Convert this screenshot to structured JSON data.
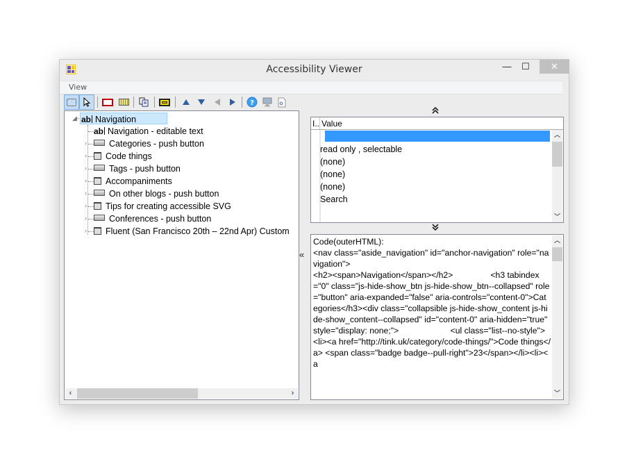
{
  "window": {
    "title": "Accessibility Viewer",
    "controls": {
      "minimize": "—",
      "maximize": "☐",
      "close": "✕"
    }
  },
  "menu": {
    "items": [
      {
        "label": "View"
      }
    ]
  },
  "toolbar": {
    "buttons": [
      {
        "name": "select-region",
        "icon": "dashed-rect-icon",
        "active": true
      },
      {
        "name": "pointer",
        "icon": "cursor-arrow-icon",
        "active": true
      },
      {
        "name": "highlight-red",
        "icon": "red-rect-icon"
      },
      {
        "name": "keyboard",
        "icon": "keyboard-icon"
      },
      {
        "name": "copy",
        "icon": "copy-icon"
      },
      {
        "name": "highlight-yellow",
        "icon": "yellow-rect-icon"
      },
      {
        "name": "nav-parent",
        "icon": "triangle-up-icon"
      },
      {
        "name": "nav-child",
        "icon": "triangle-down-icon"
      },
      {
        "name": "nav-previous",
        "icon": "triangle-left-icon"
      },
      {
        "name": "nav-next",
        "icon": "triangle-right-icon"
      },
      {
        "name": "help",
        "icon": "help-icon"
      },
      {
        "name": "screen",
        "icon": "monitor-icon"
      },
      {
        "name": "settings-doc",
        "icon": "document-gear-icon"
      }
    ]
  },
  "tree": {
    "root": {
      "icon": "ab",
      "label": "Navigation",
      "expanded": true,
      "selected": true
    },
    "children": [
      {
        "type": "editable",
        "icon": "ab",
        "label": "Navigation - editable text",
        "expandable": false
      },
      {
        "type": "button",
        "label": "Categories - push button",
        "expandable": true
      },
      {
        "type": "grouping",
        "label": "Code things",
        "expandable": true
      },
      {
        "type": "button",
        "label": "Tags - push button",
        "expandable": true
      },
      {
        "type": "grouping",
        "label": "Accompaniments",
        "expandable": true
      },
      {
        "type": "button",
        "label": "On other blogs - push button",
        "expandable": true
      },
      {
        "type": "grouping",
        "label": "Tips for creating accessible SVG",
        "expandable": true
      },
      {
        "type": "button",
        "label": "Conferences - push button",
        "expandable": true
      },
      {
        "type": "grouping",
        "label": "Fluent (San Francisco 20th – 22nd Apr) Custom",
        "expandable": true
      }
    ]
  },
  "properties": {
    "columns": {
      "index": "I..",
      "value": "Value"
    },
    "rows": [
      {
        "value": "",
        "selected": true
      },
      {
        "value": "read only , selectable"
      },
      {
        "value": "(none)"
      },
      {
        "value": "(none)"
      },
      {
        "value": "(none)"
      },
      {
        "value": "Search"
      }
    ]
  },
  "splitters": {
    "up": "⌃",
    "down": "⌄",
    "left": "«"
  },
  "code": {
    "text": "Code(outerHTML):\n<nav class=\"aside_navigation\" id=\"anchor-navigation\" role=\"navigation\">\n<h2><span>Navigation</span></h2>                <h3 tabindex=\"0\" class=\"js-hide-show_btn js-hide-show_btn--collapsed\" role=\"button\" aria-expanded=\"false\" aria-controls=\"content-0\">Categories</h3><div class=\"collapsible js-hide-show_content js-hide-show_content--collapsed\" id=\"content-0\" aria-hidden=\"true\" style=\"display: none;\">                      <ul class=\"list--no-style\">                  <li><a href=\"http://tink.uk/category/code-things/\">Code things</a> <span class=\"badge badge--pull-right\">23</span></li><li><a"
  },
  "scroll": {
    "left": "‹",
    "right": "›",
    "up": "^",
    "down": "v"
  }
}
